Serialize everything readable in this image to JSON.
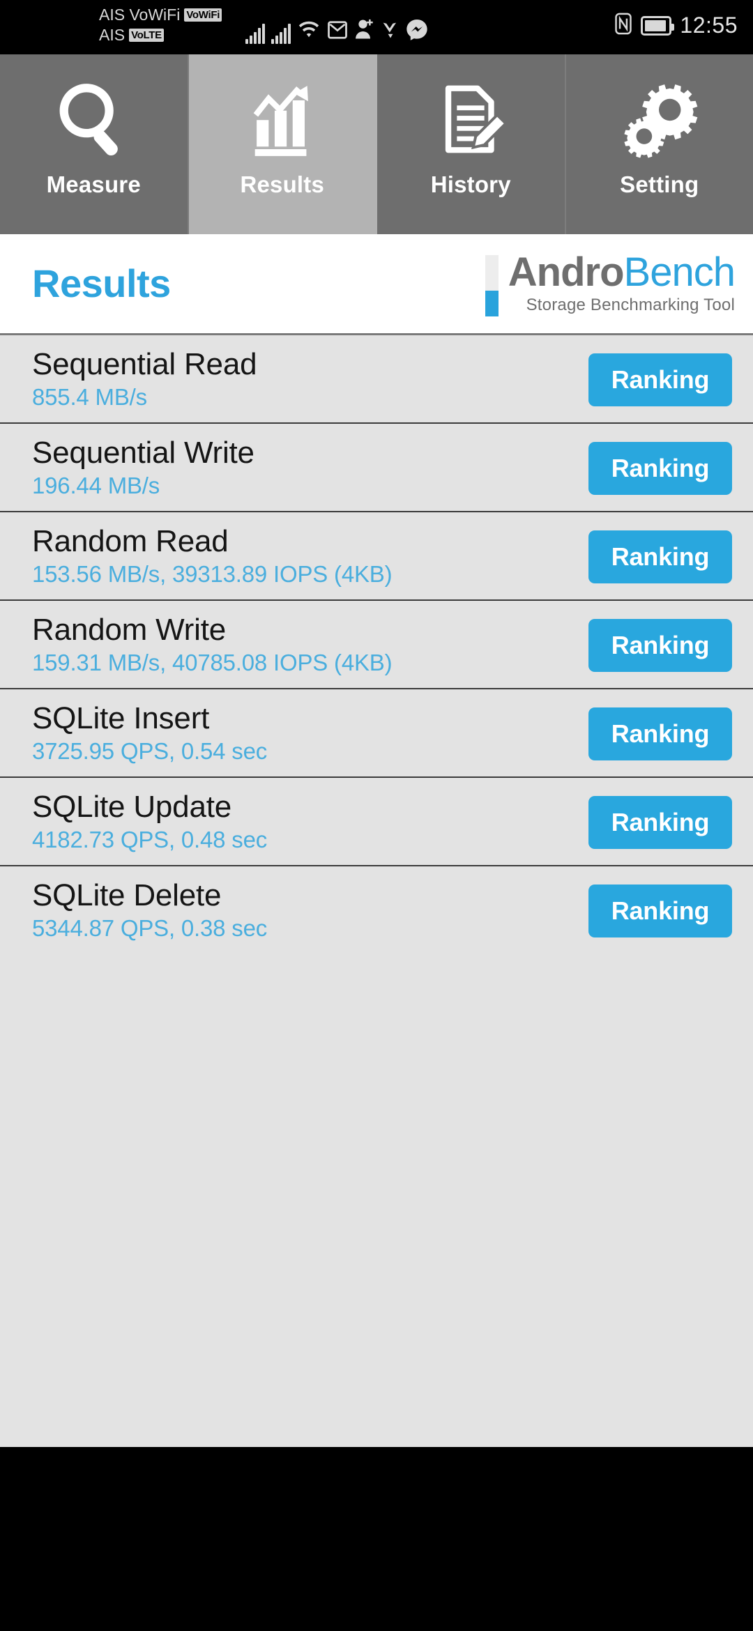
{
  "status_bar": {
    "carrier_line1": "AIS VoWiFi",
    "carrier_line1_badge": "VoWiFi",
    "carrier_line2": "AIS",
    "carrier_line2_badge": "VoLTE",
    "clock": "12:55",
    "icons": [
      "signal-bars-sim1-icon",
      "signal-bars-sim2-icon",
      "wifi-icon",
      "gmail-icon",
      "add-contact-icon",
      "bird-icon",
      "messenger-icon",
      "nfc-icon",
      "battery-icon"
    ]
  },
  "tabs": [
    {
      "label": "Measure",
      "icon": "magnifier-icon",
      "active": false
    },
    {
      "label": "Results",
      "icon": "bar-chart-arrow-icon",
      "active": true
    },
    {
      "label": "History",
      "icon": "document-pencil-icon",
      "active": false
    },
    {
      "label": "Setting",
      "icon": "gears-icon",
      "active": false
    }
  ],
  "header": {
    "page_title": "Results",
    "brand_part1": "Andro",
    "brand_part2": "Bench",
    "brand_tagline": "Storage Benchmarking Tool"
  },
  "colors": {
    "accent_blue": "#29a7de",
    "value_blue": "#4aaede",
    "brand_gray": "#6e6e6e",
    "list_bg": "#e3e3e3",
    "tab_inactive": "#6e6e6e",
    "tab_active": "#b3b3b3"
  },
  "results": [
    {
      "title": "Sequential Read",
      "value": "855.4 MB/s",
      "button": "Ranking"
    },
    {
      "title": "Sequential Write",
      "value": "196.44 MB/s",
      "button": "Ranking"
    },
    {
      "title": "Random Read",
      "value": "153.56 MB/s, 39313.89 IOPS (4KB)",
      "button": "Ranking"
    },
    {
      "title": "Random Write",
      "value": "159.31 MB/s, 40785.08 IOPS (4KB)",
      "button": "Ranking"
    },
    {
      "title": "SQLite Insert",
      "value": "3725.95 QPS, 0.54 sec",
      "button": "Ranking"
    },
    {
      "title": "SQLite Update",
      "value": "4182.73 QPS, 0.48 sec",
      "button": "Ranking"
    },
    {
      "title": "SQLite Delete",
      "value": "5344.87 QPS, 0.38 sec",
      "button": "Ranking"
    }
  ]
}
